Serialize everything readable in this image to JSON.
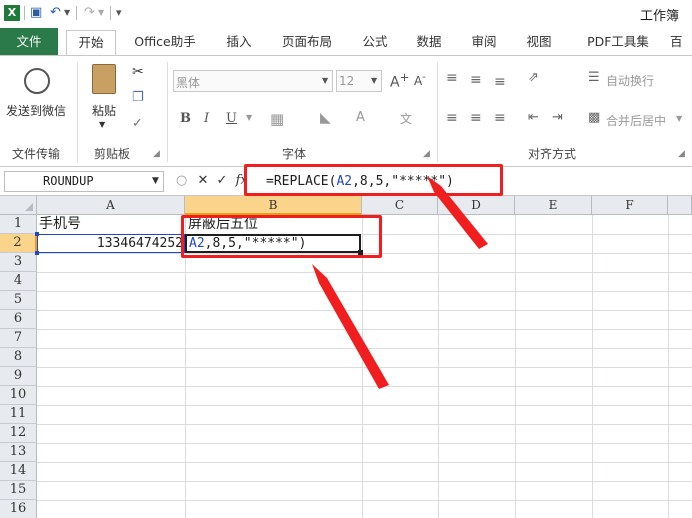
{
  "titlebar": {
    "title": "工作簿"
  },
  "tabs": {
    "file": "文件",
    "items": [
      "开始",
      "Office助手",
      "插入",
      "页面布局",
      "公式",
      "数据",
      "审阅",
      "视图",
      "PDF工具集",
      "百"
    ]
  },
  "ribbon": {
    "wechat": {
      "button": "发送到微信",
      "group": "文件传输"
    },
    "clipboard": {
      "paste": "粘贴",
      "group": "剪贴板"
    },
    "font": {
      "font_name": "黑体",
      "font_size": "12",
      "group": "字体"
    },
    "align": {
      "wrap": "自动换行",
      "merge": "合并后居中",
      "group": "对齐方式"
    }
  },
  "formula_bar": {
    "name_box": "ROUNDUP",
    "formula_prefix": "=REPLACE(",
    "formula_ref": "A2",
    "formula_suffix": ",8,5,",
    "formula_string": "\"*****\"",
    "formula_close": ")"
  },
  "grid": {
    "columns": [
      "A",
      "B",
      "C",
      "D",
      "E",
      "F"
    ],
    "rows": [
      "1",
      "2",
      "3",
      "4",
      "5",
      "6",
      "7",
      "8",
      "9",
      "10",
      "11",
      "12",
      "13",
      "14",
      "15",
      "16"
    ],
    "a1": "手机号",
    "b1": "屏蔽后五位",
    "a2": "13346474252",
    "b2_ref": "A2",
    "b2_rest": ",8,5,\"*****\")"
  },
  "colors": {
    "accent_green": "#2a7a4a",
    "annotation_red": "#f01e1e",
    "ref_blue": "#2346c7",
    "selected_header": "#f9d48a"
  }
}
